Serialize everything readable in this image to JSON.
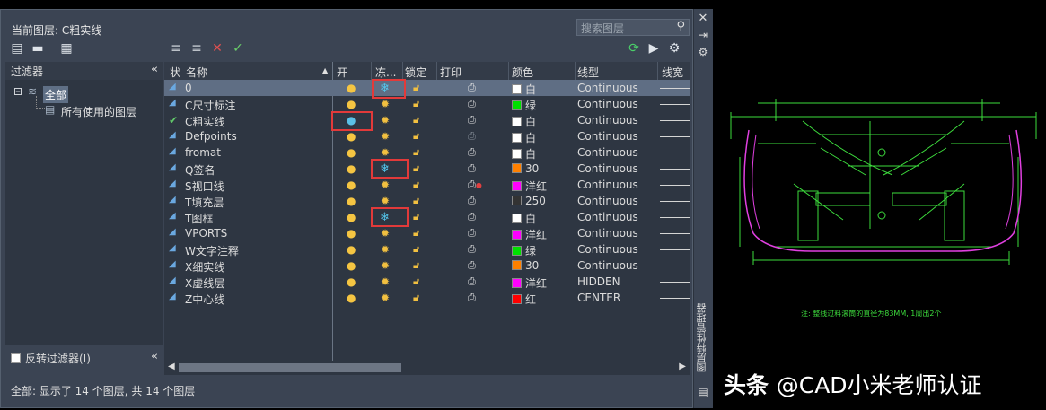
{
  "current_layer": {
    "label": "当前图层: C粗实线"
  },
  "search": {
    "placeholder": "搜索图层"
  },
  "filters": {
    "header": "过滤器",
    "collapse": "«",
    "tree": {
      "all": "全部",
      "used": "所有使用的图层"
    },
    "invert": "反转过滤器(I)"
  },
  "columns": {
    "status": "状",
    "name": "名称",
    "on": "开",
    "freeze": "冻...",
    "lock": "锁定",
    "plot": "打印",
    "color": "颜色",
    "linetype": "线型",
    "lineweight": "线宽"
  },
  "layers": [
    {
      "name": "0",
      "on": true,
      "frozen": true,
      "locked": false,
      "plot": true,
      "color_hex": "#ffffff",
      "color": "白",
      "linetype": "Continuous",
      "current": false,
      "selected": true
    },
    {
      "name": "C尺寸标注",
      "on": true,
      "frozen": false,
      "locked": false,
      "plot": true,
      "color_hex": "#00e000",
      "color": "绿",
      "linetype": "Continuous",
      "current": false
    },
    {
      "name": "C粗实线",
      "on": false,
      "frozen": false,
      "locked": false,
      "plot": true,
      "color_hex": "#ffffff",
      "color": "白",
      "linetype": "Continuous",
      "current": true
    },
    {
      "name": "Defpoints",
      "on": true,
      "frozen": false,
      "locked": false,
      "plot": false,
      "color_hex": "#ffffff",
      "color": "白",
      "linetype": "Continuous",
      "current": false
    },
    {
      "name": "fromat",
      "on": true,
      "frozen": false,
      "locked": false,
      "plot": true,
      "color_hex": "#ffffff",
      "color": "白",
      "linetype": "Continuous",
      "current": false
    },
    {
      "name": "Q签名",
      "on": true,
      "frozen": true,
      "locked": false,
      "plot": true,
      "color_hex": "#ff8000",
      "color": "30",
      "linetype": "Continuous",
      "current": false
    },
    {
      "name": "S视口线",
      "on": true,
      "frozen": false,
      "locked": false,
      "plot": "noplot",
      "color_hex": "#ff00ff",
      "color": "洋红",
      "linetype": "Continuous",
      "current": false
    },
    {
      "name": "T填充层",
      "on": true,
      "frozen": false,
      "locked": false,
      "plot": true,
      "color_hex": "#333333",
      "color": "250",
      "linetype": "Continuous",
      "current": false
    },
    {
      "name": "T图框",
      "on": true,
      "frozen": true,
      "locked": false,
      "plot": true,
      "color_hex": "#ffffff",
      "color": "白",
      "linetype": "Continuous",
      "current": false
    },
    {
      "name": "VPORTS",
      "on": true,
      "frozen": false,
      "locked": false,
      "plot": true,
      "color_hex": "#ff00ff",
      "color": "洋红",
      "linetype": "Continuous",
      "current": false
    },
    {
      "name": "W文字注释",
      "on": true,
      "frozen": false,
      "locked": false,
      "plot": true,
      "color_hex": "#00e000",
      "color": "绿",
      "linetype": "Continuous",
      "current": false
    },
    {
      "name": "X细实线",
      "on": true,
      "frozen": false,
      "locked": false,
      "plot": true,
      "color_hex": "#ff8000",
      "color": "30",
      "linetype": "Continuous",
      "current": false
    },
    {
      "name": "X虚线层",
      "on": true,
      "frozen": false,
      "locked": false,
      "plot": true,
      "color_hex": "#ff00ff",
      "color": "洋红",
      "linetype": "HIDDEN",
      "current": false
    },
    {
      "name": "Z中心线",
      "on": true,
      "frozen": false,
      "locked": false,
      "plot": true,
      "color_hex": "#ff0000",
      "color": "红",
      "linetype": "CENTER",
      "current": false
    }
  ],
  "status_bar": {
    "text": "全部: 显示了 14 个图层, 共 14 个图层"
  },
  "side_panel": {
    "title": "图层特性管理器"
  },
  "drawing": {
    "note": "注: 整线过料滚筒的直径为83MM, 1周出2个"
  },
  "watermark": {
    "brand": "头条",
    "handle": "@CAD小米老师认证"
  }
}
